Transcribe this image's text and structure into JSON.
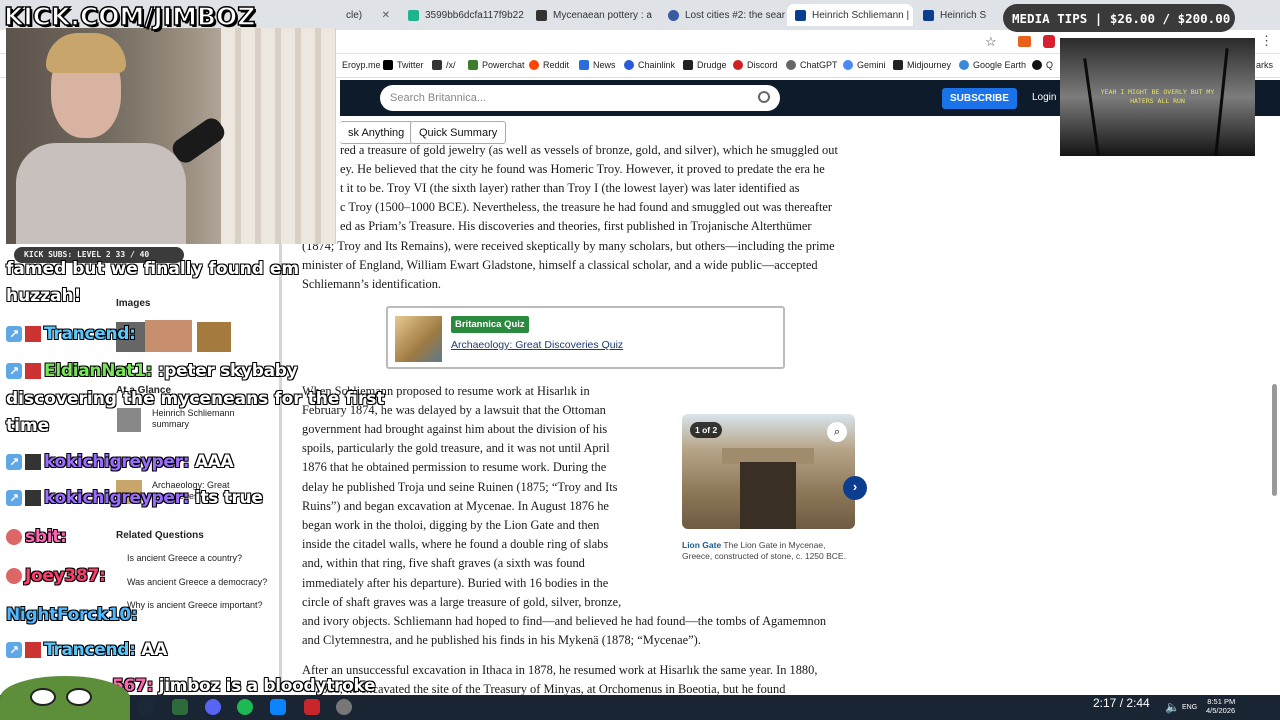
{
  "browser": {
    "tabs": [
      {
        "label": "cle)"
      },
      {
        "label": "3599bb6dcfa117f9b22"
      },
      {
        "label": "Mycenaean pottery : a"
      },
      {
        "label": "Lost cities #2: the sear"
      },
      {
        "label": "Heinrich Schliemann |"
      },
      {
        "label": "Heinrich S"
      }
    ],
    "bookmarks": [
      "Eroyp.me",
      "Twitter",
      "/x/",
      "Powerchat",
      "Reddit",
      "News",
      "Chainlink",
      "Drudge",
      "Discord",
      "ChatGPT",
      "Gemini",
      "Midjourney",
      "Google Earth",
      "Q"
    ],
    "bookmarks_right": "arks"
  },
  "site": {
    "search_placeholder": "Search Britannica...",
    "subscribe": "SUBSCRIBE",
    "login": "Login",
    "ask_anything": "sk Anything",
    "quick_summary": "Quick Summary"
  },
  "article": {
    "lines_top": [
      "red a treasure of gold jewelry (as well as vessels of bronze, gold, and silver), which he smuggled out",
      "ey. He believed that the city he found was Homeric Troy. However, it proved to predate the era he",
      "t it to be. Troy VI (the sixth layer) rather than Troy I (the lowest layer) was later identified as",
      "c Troy (1500–1000 BCE). Nevertheless, the treasure he had found and smuggled out was thereafter",
      "ed as Priam’s Treasure. His discoveries and theories, first published in Trojanische Alterthümer",
      "(1874; Troy and Its Remains), were received skeptically by many scholars, but others—including the prime",
      "minister of England, William Ewart Gladstone, himself a classical scholar, and a wide public—accepted",
      "Schliemann’s identification."
    ],
    "quiz_badge": "Britannica Quiz",
    "quiz_link": "Archaeology: Great Discoveries Quiz",
    "lines_mid": [
      "When Schliemann proposed to resume work at Hisarlık in",
      "February 1874, he was delayed by a lawsuit that the Ottoman",
      "government had brought against him about the division of his",
      "spoils, particularly the gold treasure, and it was not until April",
      "1876 that he obtained permission to resume work. During the",
      "delay he published Troja und seine Ruinen (1875; “Troy and Its",
      "Ruins”) and began excavation at Mycenae. In August 1876 he",
      "began work in the tholoi, digging by the Lion Gate and then",
      "inside the citadel walls, where he found a double ring of slabs",
      "and, within that ring, five shaft graves (a sixth was found",
      "immediately after his departure). Buried with 16 bodies in the",
      "circle of shaft graves was a large treasure of gold, silver, bronze,",
      "and ivory objects. Schliemann had hoped to find—and believed he had found—the tombs of Agamemnon",
      "and Clytemnestra, and he published his finds in his Mykenä (1878; “Mycenae”)."
    ],
    "lines_bottom": [
      "After an unsuccessful excavation in Ithaca in 1878, he resumed work at Hisarlık the same year. In 1880,",
      "1886, he excavated the site of the Treasury of Minyas, at Orchomenus in Boeotia, but he found"
    ],
    "gallery_count": "1 of 2",
    "caption_title": "Lion Gate",
    "caption_text": "The Lion Gate in Mycenae, Greece, constructed of stone, c. 1250 BCE."
  },
  "sidebar": {
    "images_label": "Images",
    "glance_label": "At a Glance",
    "glance_item": "Heinrich Schliemann summary",
    "quiz_item": "Archaeology: Great Discoveries Quiz",
    "related_label": "Related Questions",
    "questions": [
      "Is ancient Greece a country?",
      "Was ancient Greece a democracy?",
      "Why is ancient Greece important?"
    ]
  },
  "stream": {
    "brand": "KICK.COM/JIMBOZ",
    "subs": "KICK SUBS: LEVEL 2 33 / 40",
    "media_tips": "MEDIA TIPS | $26.00 / $200.00",
    "video_text": "YEAH I MIGHT BE OVERLY\nBUT MY HATERS ALL RUN"
  },
  "chat": [
    {
      "user": "",
      "msg": "famed but we finally found em",
      "color": "#ffffff"
    },
    {
      "user": "",
      "msg": "huzzah!",
      "color": "#ffffff"
    },
    {
      "user": "Trancend:",
      "msg": "",
      "color": "#59c7ff"
    },
    {
      "user": "EldianNat1:",
      "msg": ":peter skybaby",
      "color": "#79e65a"
    },
    {
      "user": "",
      "msg": "discovering the myceneans for the first",
      "color": "#ffffff"
    },
    {
      "user": "",
      "msg": "time",
      "color": "#ffffff"
    },
    {
      "user": "kokichigreyper:",
      "msg": "AAA",
      "color": "#9b6cff"
    },
    {
      "user": "kokichigreyper:",
      "msg": "its true",
      "color": "#9b6cff"
    },
    {
      "user": "sbit:",
      "msg": "",
      "color": "#ff66b3"
    },
    {
      "user": "Joey387:",
      "msg": "",
      "color": "#ff3d6e"
    },
    {
      "user": "NightForck10:",
      "msg": "",
      "color": "#4db8ff"
    },
    {
      "user": "Trancend:",
      "msg": "AA",
      "color": "#59c7ff"
    },
    {
      "user": "567:",
      "msg": "jimboz is a bloodytroke",
      "color": "#ff66b3"
    }
  ],
  "taskbar": {
    "media_time": "2:17 / 2:44",
    "time": "8:51 PM",
    "date": "4/5/2026",
    "lang": "ENG"
  },
  "colors": {
    "link": "#1a5a8f",
    "header": "#0d1b2a",
    "subscribe": "#1a73e8",
    "quiz_badge": "#2a8a3e"
  }
}
